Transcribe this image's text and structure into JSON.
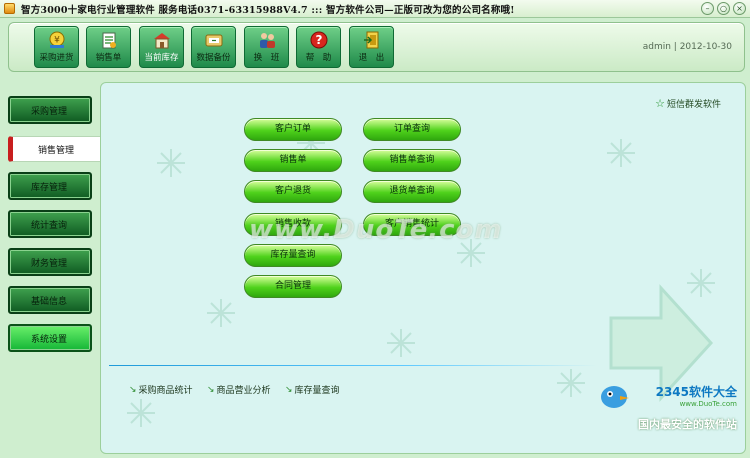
{
  "window": {
    "title": "智方3000十家电行业管理软件   服务电话0371-63315988V4.7 :::  智方软件公司—正版可改为您的公司名称哦!"
  },
  "toolbar": {
    "buttons": [
      {
        "label": "采购进货",
        "icon": "cart-money-icon"
      },
      {
        "label": "销售单",
        "icon": "sales-list-icon"
      },
      {
        "label": "当前库存",
        "icon": "warehouse-house-icon"
      },
      {
        "label": "数据备份",
        "icon": "backup-icon"
      },
      {
        "label": "换　班",
        "icon": "shift-change-icon"
      },
      {
        "label": "帮　助",
        "icon": "help-icon"
      },
      {
        "label": "退　出",
        "icon": "exit-icon"
      }
    ],
    "user_info": "admin | 2012-10-30"
  },
  "sidebar": {
    "items": [
      {
        "label": "采购管理"
      },
      {
        "label": "销售管理"
      },
      {
        "label": "库存管理"
      },
      {
        "label": "统计查询"
      },
      {
        "label": "财务管理"
      },
      {
        "label": "基础信息"
      },
      {
        "label": "系统设置"
      }
    ]
  },
  "main": {
    "sms_link": "短信群发软件",
    "left_buttons": [
      {
        "label": "客户订单"
      },
      {
        "label": "销售单"
      },
      {
        "label": "客户退货"
      },
      {
        "label": "销售收款"
      },
      {
        "label": "库存量查询"
      },
      {
        "label": "合同管理"
      }
    ],
    "right_buttons": [
      {
        "label": "订单查询"
      },
      {
        "label": "销售单查询"
      },
      {
        "label": "退货单查询"
      },
      {
        "label": "客户销售统计"
      }
    ],
    "bottom_links": [
      {
        "label": "采购商品统计"
      },
      {
        "label": "商品营业分析"
      },
      {
        "label": "库存量查询"
      }
    ]
  },
  "overlays": {
    "watermark": "www.DuoTe.com",
    "brand_2345": "2345软件大全",
    "brand_url": "www.DuoTe.com",
    "brand_tagline": "国内最安全的软件站"
  },
  "colors": {
    "accent_green": "#2fa80e",
    "active_marker": "#c81e1e",
    "divider_blue": "#1f9ad9"
  }
}
